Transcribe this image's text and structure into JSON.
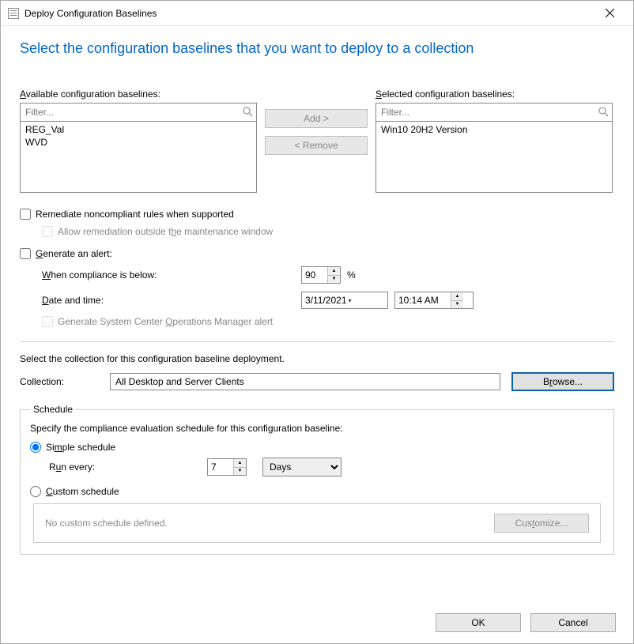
{
  "window": {
    "title": "Deploy Configuration Baselines"
  },
  "heading": "Select the configuration baselines that you want to deploy to a collection",
  "available": {
    "label_pre": "A",
    "label_rest": "vailable configuration baselines:",
    "filter_placeholder": "Filter...",
    "items": [
      "REG_Val",
      "WVD"
    ]
  },
  "selected": {
    "label_pre": "S",
    "label_rest": "elected configuration baselines:",
    "filter_placeholder": "Filter...",
    "items": [
      "Win10 20H2 Version"
    ]
  },
  "buttons": {
    "add": "Add >",
    "remove": "< Remove",
    "browse": "Browse...",
    "customize": "Customize...",
    "ok": "OK",
    "cancel": "Cancel"
  },
  "options": {
    "remediate": "Remediate noncompliant rules when supported",
    "allow_remediation": "Allow remediation outside the maintenance window",
    "generate_alert": "Generate an alert:",
    "when_below": "When compliance is below:",
    "date_time": "Date and time:",
    "gen_scom": "Generate System Center Operations Manager alert"
  },
  "alert": {
    "compliance_threshold": "90",
    "percent": "%",
    "date": "3/11/2021",
    "time": "10:14 AM"
  },
  "collection_section": {
    "prompt": "Select the collection for this configuration baseline deployment.",
    "label": "Collection:",
    "value": "All Desktop and Server Clients"
  },
  "schedule": {
    "legend": "Schedule",
    "desc": "Specify the compliance evaluation schedule for this configuration baseline:",
    "simple": "Simple schedule",
    "custom": "Custom schedule",
    "run_every": "Run every:",
    "value": "7",
    "unit": "Days",
    "no_custom": "No custom schedule defined."
  }
}
